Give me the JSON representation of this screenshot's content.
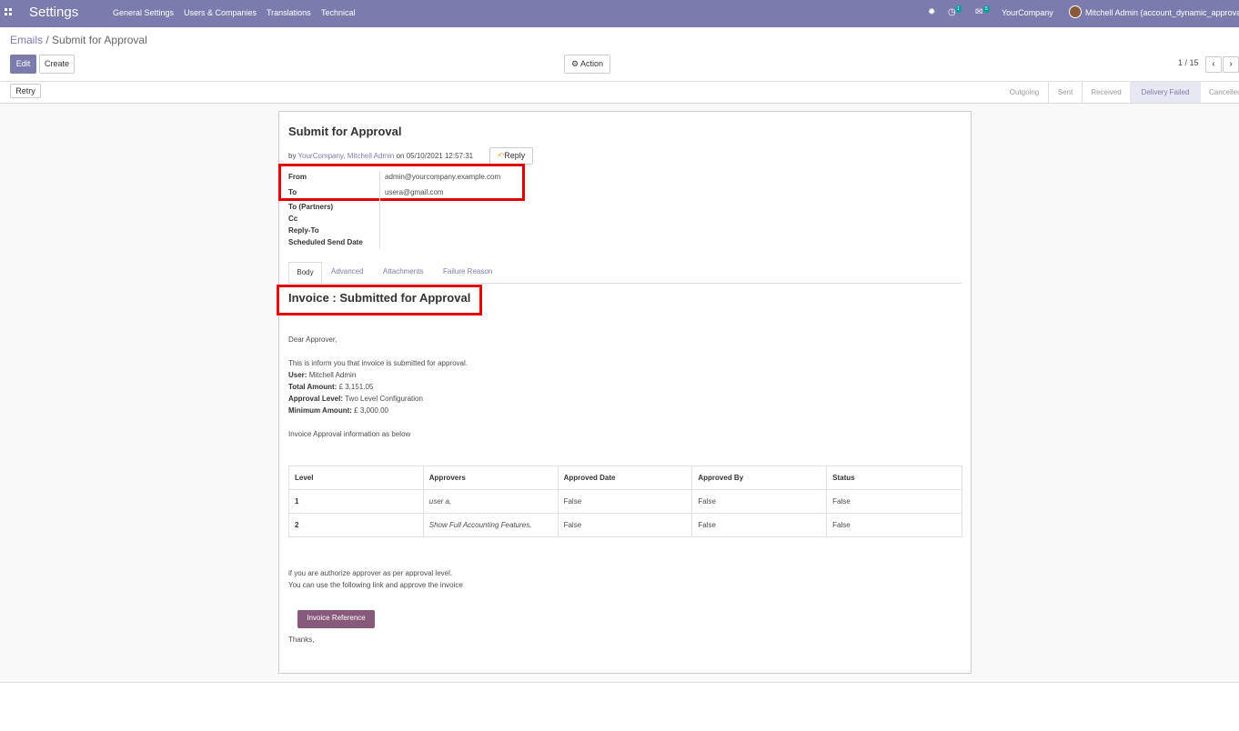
{
  "nav": {
    "app_title": "Settings",
    "menu": [
      "General Settings",
      "Users & Companies",
      "Translations",
      "Technical"
    ],
    "activity_count": "1",
    "message_count": "5",
    "company": "YourCompany",
    "user": "Mitchell Admin (account_dynamic_approval)"
  },
  "breadcrumb": {
    "parent": "Emails",
    "sep": "/",
    "current": "Submit for Approval"
  },
  "buttons": {
    "edit": "Edit",
    "create": "Create",
    "action": "Action",
    "retry": "Retry"
  },
  "pager": {
    "value": "1 / 15"
  },
  "statusbar": [
    "Outgoing",
    "Sent",
    "Received",
    "Delivery Failed",
    "Cancelled"
  ],
  "statusbar_active": "Delivery Failed",
  "message": {
    "subject": "Submit for Approval",
    "by": "by",
    "author": "YourCompany, Mitchell Admin",
    "on": "on 05/10/2021 12:57:31",
    "reply": "Reply",
    "fields": [
      {
        "label": "From",
        "value": "admin@yourcompany.example.com"
      },
      {
        "label": "To",
        "value": "usera@gmail.com"
      },
      {
        "label": "To (Partners)",
        "value": ""
      },
      {
        "label": "Cc",
        "value": ""
      },
      {
        "label": "Reply-To",
        "value": ""
      },
      {
        "label": "Scheduled Send Date",
        "value": ""
      }
    ]
  },
  "tabs": [
    "Body",
    "Advanced",
    "Attachments",
    "Failure Reason"
  ],
  "body": {
    "heading": "Invoice : Submitted for Approval",
    "greeting": "Dear Approver,",
    "intro": "This is inform you that invoice is submitted for approval.",
    "user_label": "User:",
    "user_value": "Mitchell Admin",
    "amount_label": "Total Amount:",
    "amount_value": "£ 3,151.05",
    "level_label": "Approval Level:",
    "level_value": "Two Level Configuration",
    "min_label": "Minimum Amount:",
    "min_value": "£ 3,000.00",
    "info": "Invoice Approval information as below",
    "table": {
      "headers": [
        "Level",
        "Approvers",
        "Approved Date",
        "Approved By",
        "Status"
      ],
      "rows": [
        [
          "1",
          "user a,",
          "False",
          "False",
          "False"
        ],
        [
          "2",
          "Show Full Accounting Features,",
          "False",
          "False",
          "False"
        ]
      ]
    },
    "closing1": "if you are authorize approver as per approval level.",
    "closing2": "You can use the following link and approve the invoice",
    "button": "Invoice Reference",
    "thanks": "Thanks,"
  },
  "colors": {
    "navbar": "#7c7bad",
    "highlight": "#e00000",
    "invoice_button": "#875a7b"
  }
}
